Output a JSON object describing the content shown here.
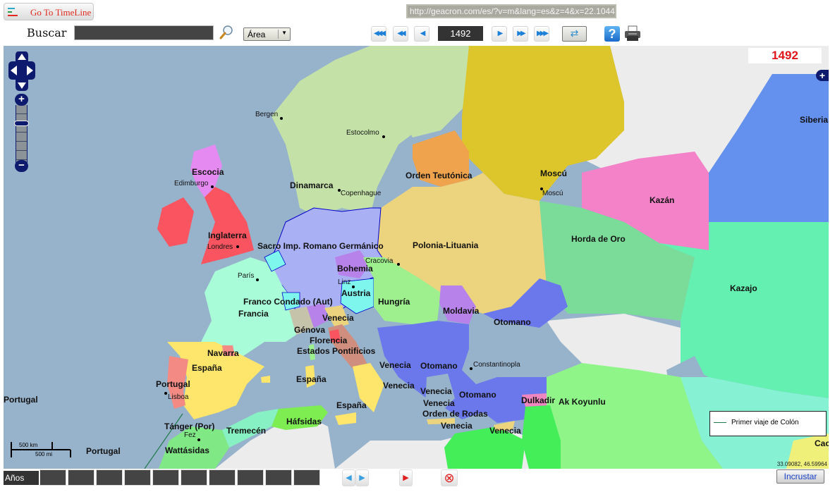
{
  "toolbar": {
    "goto_timeline_label": "Go To TimeLine",
    "search_label": "Buscar",
    "search_value": "",
    "search_type_selected": "Área",
    "url": "http://geacron.com/es/?v=m&lang=es&z=4&x=22.1044",
    "year": "1492",
    "nav_buttons": [
      {
        "name": "first-button",
        "glyph": "◀◀◀"
      },
      {
        "name": "fast-back-button",
        "glyph": "◀◀"
      },
      {
        "name": "back-button",
        "glyph": "◀"
      },
      {
        "name": "forward-button",
        "glyph": "▶"
      },
      {
        "name": "fast-forward-button",
        "glyph": "▶▶"
      },
      {
        "name": "last-button",
        "glyph": "▶▶▶"
      }
    ],
    "refresh_glyph": "⇄",
    "help_glyph": "?"
  },
  "map": {
    "year_badge": "1492",
    "expand_glyph": "+",
    "zoom_in_glyph": "+",
    "zoom_out_glyph": "−",
    "coordinates": "33.09082, 46.59964",
    "scale_km": "500 km",
    "scale_mi": "500 mi",
    "legend": {
      "item": "Primer viaje de Colón",
      "color": "#1e7a4a"
    },
    "colors": {
      "sea": "#97b2cb",
      "unclaimed": "#ececec",
      "scandinavia": "#c4e2a8",
      "moscow": "#dcc62b",
      "teutonic": "#f0a34d",
      "poland": "#ecd47e",
      "hre": "#aab0f4",
      "golden_horde": "#7bdc9a",
      "kazan": "#f482c8",
      "kazakh": "#63f0b0",
      "siberia": "#6490ee",
      "ottoman": "#6b78ec",
      "hungary": "#9ef08e",
      "france": "#a8fcd8",
      "spain": "#fde66b",
      "portugal": "#f38a84",
      "england": "#f9545f",
      "scotland": "#e58af0",
      "austria": "#7ef6ee",
      "bohemia": "#b782ea",
      "maghreb": "#81e886",
      "hafsids": "#7ded52",
      "tlemcen": "#87f1c4",
      "aq_qoyunlu": "#8ff589",
      "mamluk": "#43ee59",
      "dulkadir": "#f086c0"
    },
    "realm_labels": [
      {
        "text": "Escocia"
      },
      {
        "text": "Inglaterra"
      },
      {
        "text": "Dinamarca"
      },
      {
        "text": "Orden Teutónica"
      },
      {
        "text": "Moscú"
      },
      {
        "text": "Kazán"
      },
      {
        "text": "Siberia"
      },
      {
        "text": "Horda de Oro"
      },
      {
        "text": "Kazajo"
      },
      {
        "text": "Sacro Imp. Romano Germánico"
      },
      {
        "text": "Polonia-Lituania"
      },
      {
        "text": "Bohemia"
      },
      {
        "text": "Austria"
      },
      {
        "text": "Hungría"
      },
      {
        "text": "Moldavia"
      },
      {
        "text": "Otomano"
      },
      {
        "text": "Franco Condado (Aut)"
      },
      {
        "text": "Francia"
      },
      {
        "text": "Venecia"
      },
      {
        "text": "Génova"
      },
      {
        "text": "Florencia"
      },
      {
        "text": "Estados Pontificios"
      },
      {
        "text": "Navarra"
      },
      {
        "text": "España"
      },
      {
        "text": "Portugal"
      },
      {
        "text": "España"
      },
      {
        "text": "Venecia"
      },
      {
        "text": "Otomano"
      },
      {
        "text": "Venecia"
      },
      {
        "text": "Venecia"
      },
      {
        "text": "Otomano"
      },
      {
        "text": "Venecia"
      },
      {
        "text": "Orden de Rodas"
      },
      {
        "text": "Venecia"
      },
      {
        "text": "Venecia"
      },
      {
        "text": "Dulkadir"
      },
      {
        "text": "Ak Koyunlu"
      },
      {
        "text": "España"
      },
      {
        "text": "Portugal"
      },
      {
        "text": "Tánger (Por)"
      },
      {
        "text": "Tremecén"
      },
      {
        "text": "Háfsidas"
      },
      {
        "text": "Wattásidas"
      },
      {
        "text": "Portugal"
      },
      {
        "text": "Cac"
      }
    ],
    "cities": [
      {
        "text": "Bergen"
      },
      {
        "text": "Estocolmo"
      },
      {
        "text": "Edimburgo"
      },
      {
        "text": "Copenhague"
      },
      {
        "text": "Moscú"
      },
      {
        "text": "Londres"
      },
      {
        "text": "Cracovia"
      },
      {
        "text": "París"
      },
      {
        "text": "Linz"
      },
      {
        "text": "Constantinopla"
      },
      {
        "text": "Lisboa"
      },
      {
        "text": "Fez"
      }
    ]
  },
  "timeline": {
    "label": "Años",
    "slots": [
      "",
      "",
      "",
      "",
      "",
      "",
      "",
      "",
      "",
      ""
    ],
    "prev_glyph": "◀",
    "next_glyph": "▶",
    "play_glyph": "▶",
    "stop_glyph": "⊗",
    "embed_label": "Incrustar"
  }
}
